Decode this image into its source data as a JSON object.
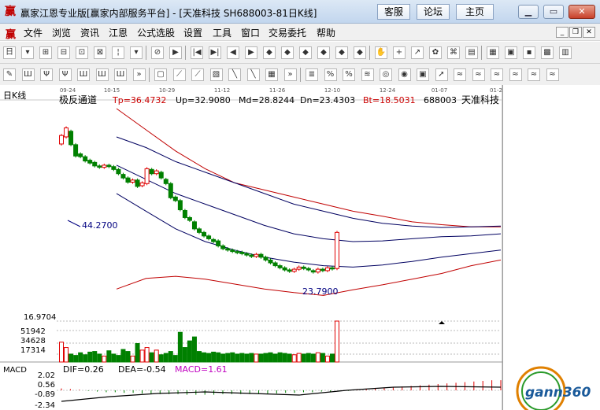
{
  "titlebar": {
    "logo": "赢",
    "title": "赢家江恩专业版[赢家内部服务平台] - [天准科技  SH688003-81日K线]",
    "links": [
      "客服",
      "论坛",
      "主页"
    ]
  },
  "menubar": {
    "logo": "赢",
    "items": [
      "文件",
      "浏览",
      "资讯",
      "江恩",
      "公式选股",
      "设置",
      "工具",
      "窗口",
      "交易委托",
      "帮助"
    ]
  },
  "chart": {
    "period": "日K线",
    "dates": [
      "09-24",
      "10-15",
      "10-29",
      "11-12",
      "11-26",
      "12-10",
      "12-24",
      "01-07",
      "01-2"
    ],
    "indicator": "极反通道",
    "params": [
      {
        "label": "Tp=36.4732",
        "color": "#cc0000"
      },
      {
        "label": "Up=32.9080",
        "color": "#000000"
      },
      {
        "label": "Md=28.8244",
        "color": "#000000"
      },
      {
        "label": "Dn=23.4303",
        "color": "#000000"
      },
      {
        "label": "Bt=18.5031",
        "color": "#cc0000"
      }
    ],
    "code": "688003",
    "name": "天准科技",
    "high_label": "44.2700",
    "low_label": "23.7900",
    "axis_min": "16.9704",
    "volume_ticks": [
      "51942",
      "34628",
      "17314"
    ],
    "macd": {
      "name": "MACD",
      "dif": "DIF=0.26",
      "dea": "DEA=-0.54",
      "macd": "MACD=1.61",
      "ticks": [
        "2.02",
        "0.56",
        "-0.89",
        "-2.34"
      ]
    }
  },
  "chart_data": {
    "type": "candlestick",
    "title": "",
    "xlabel": "",
    "ylabel": "",
    "candles": [
      {
        "o": 42.0,
        "c": 43.2
      },
      {
        "o": 43.0,
        "c": 44.27
      },
      {
        "o": 43.8,
        "c": 41.9
      },
      {
        "o": 41.9,
        "c": 40.3
      },
      {
        "o": 40.6,
        "c": 40.2
      },
      {
        "o": 40.2,
        "c": 39.6
      },
      {
        "o": 39.7,
        "c": 39.3
      },
      {
        "o": 39.4,
        "c": 38.9
      },
      {
        "o": 38.9,
        "c": 38.7
      },
      {
        "o": 38.7,
        "c": 39.0
      },
      {
        "o": 39.0,
        "c": 38.8
      },
      {
        "o": 38.8,
        "c": 38.4
      },
      {
        "o": 38.4,
        "c": 37.8
      },
      {
        "o": 37.7,
        "c": 37.2
      },
      {
        "o": 37.2,
        "c": 36.6
      },
      {
        "o": 36.6,
        "c": 36.9
      },
      {
        "o": 36.9,
        "c": 36.0
      },
      {
        "o": 36.1,
        "c": 36.5
      },
      {
        "o": 36.4,
        "c": 38.5
      },
      {
        "o": 38.4,
        "c": 37.8
      },
      {
        "o": 37.8,
        "c": 38.2
      },
      {
        "o": 38.0,
        "c": 37.2
      },
      {
        "o": 37.0,
        "c": 36.4
      },
      {
        "o": 36.4,
        "c": 34.4
      },
      {
        "o": 34.5,
        "c": 34.0
      },
      {
        "o": 34.0,
        "c": 32.7
      },
      {
        "o": 32.6,
        "c": 31.6
      },
      {
        "o": 31.6,
        "c": 31.2
      },
      {
        "o": 31.0,
        "c": 30.0
      },
      {
        "o": 30.0,
        "c": 29.5
      },
      {
        "o": 29.5,
        "c": 29.0
      },
      {
        "o": 29.0,
        "c": 28.6
      },
      {
        "o": 28.5,
        "c": 28.2
      },
      {
        "o": 28.3,
        "c": 27.6
      },
      {
        "o": 27.6,
        "c": 27.2
      },
      {
        "o": 27.2,
        "c": 27.0
      },
      {
        "o": 27.0,
        "c": 26.8
      },
      {
        "o": 26.8,
        "c": 26.7
      },
      {
        "o": 26.7,
        "c": 26.5
      },
      {
        "o": 26.5,
        "c": 26.3
      },
      {
        "o": 26.3,
        "c": 26.1
      },
      {
        "o": 26.1,
        "c": 26.4
      },
      {
        "o": 26.4,
        "c": 26.0
      },
      {
        "o": 26.0,
        "c": 25.6
      },
      {
        "o": 25.6,
        "c": 25.2
      },
      {
        "o": 25.2,
        "c": 24.8
      },
      {
        "o": 24.8,
        "c": 24.5
      },
      {
        "o": 24.5,
        "c": 24.2
      },
      {
        "o": 24.2,
        "c": 24.0
      },
      {
        "o": 24.0,
        "c": 24.3
      },
      {
        "o": 24.3,
        "c": 24.6
      },
      {
        "o": 24.6,
        "c": 24.4
      },
      {
        "o": 24.4,
        "c": 24.2
      },
      {
        "o": 24.1,
        "c": 23.9
      },
      {
        "o": 23.9,
        "c": 24.3
      },
      {
        "o": 24.3,
        "c": 24.1
      },
      {
        "o": 24.1,
        "c": 24.5
      },
      {
        "o": 24.5,
        "c": 24.4
      },
      {
        "o": 24.4,
        "c": 29.5
      }
    ],
    "volume": [
      30000,
      22000,
      12000,
      10000,
      14000,
      11000,
      15000,
      16000,
      12000,
      9000,
      17000,
      12000,
      10000,
      19000,
      16000,
      9000,
      28000,
      18000,
      22000,
      14000,
      18000,
      11000,
      13000,
      16000,
      10000,
      45000,
      22000,
      32000,
      38000,
      16000,
      14000,
      13000,
      15000,
      14000,
      12000,
      13000,
      14000,
      12000,
      13000,
      12000,
      13000,
      12000,
      12000,
      13000,
      14000,
      12000,
      14000,
      13000,
      12000,
      11000,
      13000,
      12000,
      13000,
      12000,
      14000,
      13000,
      9000,
      12000,
      62000
    ],
    "bands": {
      "tp": [
        47.0,
        44.0,
        41.0,
        38.5,
        36.5,
        35.5,
        34.5,
        33.5,
        32.5,
        31.8,
        31.0,
        30.6,
        30.3,
        30.3
      ],
      "up": [
        43.0,
        41.5,
        39.5,
        38.0,
        36.5,
        35.0,
        33.5,
        32.5,
        31.5,
        30.8,
        30.4,
        30.2,
        30.3,
        30.4
      ],
      "md": [
        39.0,
        37.0,
        35.0,
        33.5,
        32.0,
        30.5,
        29.3,
        28.6,
        28.2,
        28.3,
        28.6,
        28.9,
        29.0,
        29.3
      ],
      "dn": [
        35.0,
        32.5,
        30.0,
        28.2,
        27.0,
        26.0,
        25.3,
        24.8,
        24.6,
        24.9,
        25.4,
        26.0,
        26.5,
        27.0
      ],
      "bt": [
        21.5,
        23.0,
        23.3,
        22.9,
        22.2,
        21.5,
        21.0,
        20.6,
        21.4,
        22.1,
        22.9,
        23.7,
        24.8,
        25.6
      ]
    },
    "macd_hist": [
      0.3,
      0.2,
      0.1,
      -0.1,
      -0.2,
      -0.3,
      -0.3,
      -0.4,
      -0.4,
      -0.5,
      -0.5,
      -0.6,
      -0.6,
      -0.6,
      -0.7,
      -0.7,
      -0.7,
      -0.7,
      -0.6,
      -0.6,
      -0.6,
      -0.6,
      -0.5,
      -0.5,
      -0.5,
      -0.4,
      -0.4,
      -0.3,
      -0.3,
      -0.2,
      -0.2,
      -0.1,
      -0.1,
      0.1,
      0.2,
      0.3,
      0.4,
      0.5,
      0.6,
      0.7,
      0.8,
      0.9,
      1.0,
      1.1,
      1.2,
      1.3,
      1.4,
      1.5,
      1.6,
      1.61
    ],
    "ylim": [
      16.9704,
      47.0
    ]
  },
  "watermark": {
    "text": "gann360"
  }
}
